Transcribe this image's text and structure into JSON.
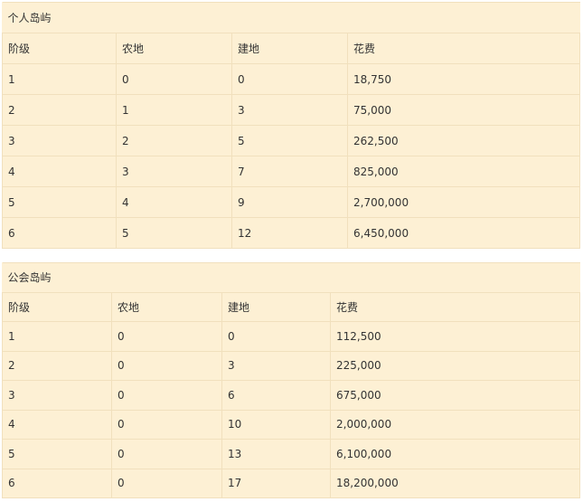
{
  "tables": [
    {
      "title": "个人岛屿",
      "headers": [
        "阶级",
        "农地",
        "建地",
        "花费"
      ],
      "rows": [
        [
          "1",
          "0",
          "0",
          "18,750"
        ],
        [
          "2",
          "1",
          "3",
          "75,000"
        ],
        [
          "3",
          "2",
          "5",
          "262,500"
        ],
        [
          "4",
          "3",
          "7",
          "825,000"
        ],
        [
          "5",
          "4",
          "9",
          "2,700,000"
        ],
        [
          "6",
          "5",
          "12",
          "6,450,000"
        ]
      ]
    },
    {
      "title": "公会岛屿",
      "headers": [
        "阶级",
        "农地",
        "建地",
        "花费"
      ],
      "rows": [
        [
          "1",
          "0",
          "0",
          "112,500"
        ],
        [
          "2",
          "0",
          "3",
          "225,000"
        ],
        [
          "3",
          "0",
          "6",
          "675,000"
        ],
        [
          "4",
          "0",
          "10",
          "2,000,000"
        ],
        [
          "5",
          "0",
          "13",
          "6,100,000"
        ],
        [
          "6",
          "0",
          "17",
          "18,200,000"
        ]
      ]
    }
  ]
}
